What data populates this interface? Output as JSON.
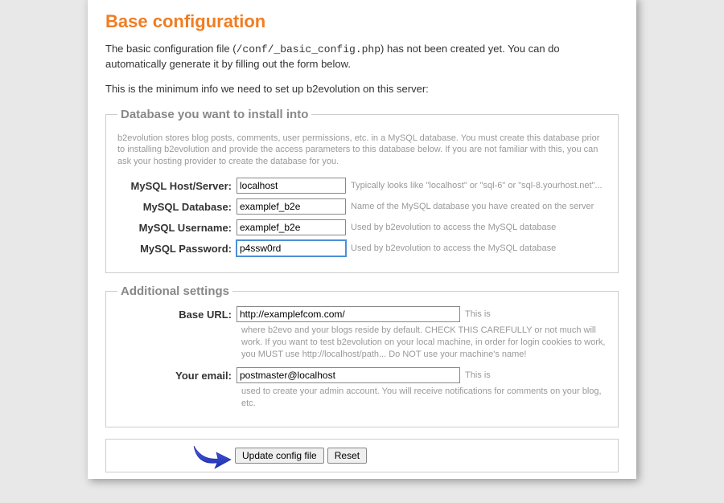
{
  "title": "Base configuration",
  "intro": {
    "line1a": "The basic configuration file (",
    "line1_code": "/conf/_basic_config.php",
    "line1b": ") has not been created yet. You can do automatically generate it by filling out the form below.",
    "line2": "This is the minimum info we need to set up b2evolution on this server:"
  },
  "db": {
    "legend": "Database you want to install into",
    "note": "b2evolution stores blog posts, comments, user permissions, etc. in a MySQL database. You must create this database prior to installing b2evolution and provide the access parameters to this database below. If you are not familiar with this, you can ask your hosting provider to create the database for you.",
    "host": {
      "label": "MySQL Host/Server:",
      "value": "localhost",
      "hint": "Typically looks like \"localhost\" or \"sql-6\" or \"sql-8.yourhost.net\"..."
    },
    "database": {
      "label": "MySQL Database:",
      "value": "examplef_b2e",
      "hint": "Name of the MySQL database you have created on the server"
    },
    "username": {
      "label": "MySQL Username:",
      "value": "examplef_b2e",
      "hint": "Used by b2evolution to access the MySQL database"
    },
    "password": {
      "label": "MySQL Password:",
      "value": "p4ssw0rd",
      "hint": "Used by b2evolution to access the MySQL database"
    }
  },
  "additional": {
    "legend": "Additional settings",
    "baseurl": {
      "label": "Base URL:",
      "value": "http://examplefcom.com/",
      "hint_inline": "This is",
      "hint_below": "where b2evo and your blogs reside by default. CHECK THIS CAREFULLY or not much will work. If you want to test b2evolution on your local machine, in order for login cookies to work, you MUST use http://localhost/path... Do NOT use your machine's name!"
    },
    "email": {
      "label": "Your email:",
      "value": "postmaster@localhost",
      "hint_inline": "This is",
      "hint_below": "used to create your admin account. You will receive notifications for comments on your blog, etc."
    }
  },
  "buttons": {
    "update": "Update config file",
    "reset": "Reset"
  }
}
